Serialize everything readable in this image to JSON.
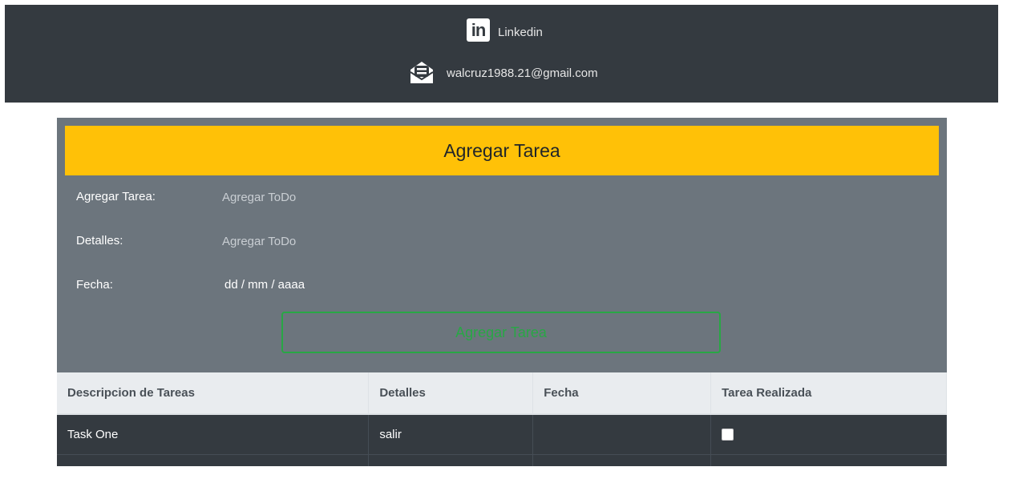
{
  "header": {
    "linkedin": {
      "icon": "linkedin-icon",
      "label": "Linkedin"
    },
    "email": {
      "icon": "mail-open-icon",
      "label": "walcruz1988.21@gmail.com"
    }
  },
  "form": {
    "title": "Agregar Tarea",
    "fields": [
      {
        "label": "Agregar Tarea:",
        "placeholder": "Agregar ToDo",
        "value": ""
      },
      {
        "label": "Detalles:",
        "placeholder": "Agregar ToDo",
        "value": ""
      },
      {
        "label": "Fecha:",
        "value": "dd / mm / aaaa"
      }
    ],
    "submit_label": "Agregar Tarea"
  },
  "table": {
    "headers": [
      "Descripcion de Tareas",
      "Detalles",
      "Fecha",
      "Tarea Realizada"
    ],
    "rows": [
      {
        "description": "Task One",
        "details": "salir",
        "date": "",
        "done": false
      }
    ]
  },
  "colors": {
    "header_bg": "#343a40",
    "card_bg": "#6c757d",
    "accent_yellow": "#ffc107",
    "success_green": "#28a745"
  }
}
